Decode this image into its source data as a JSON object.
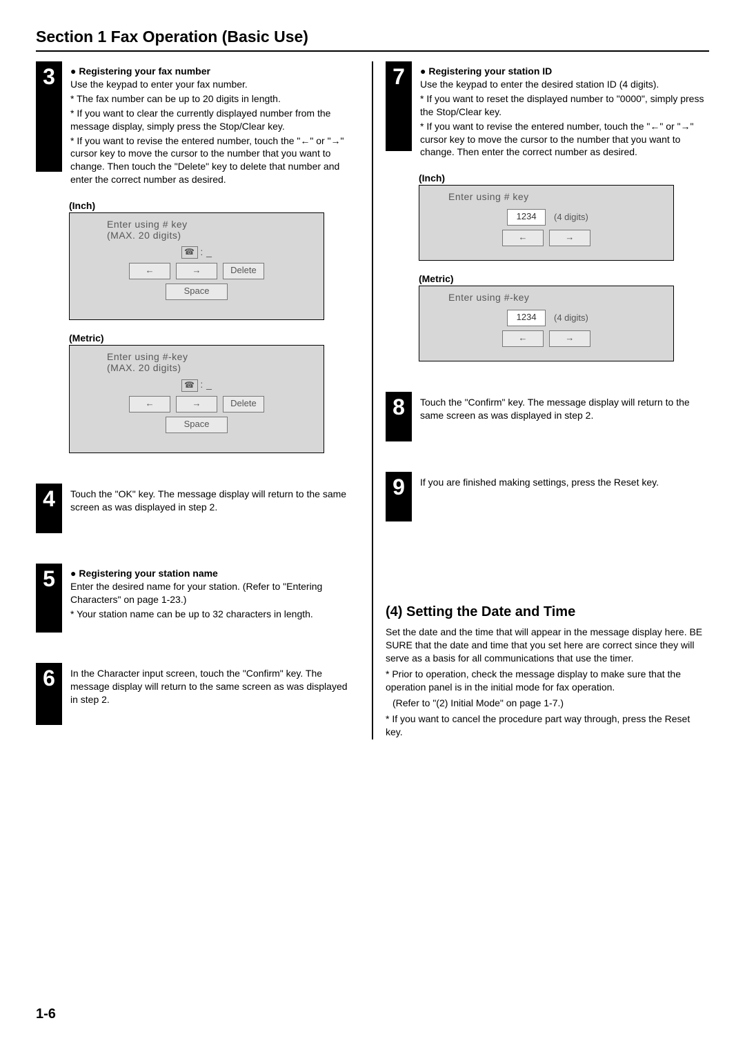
{
  "page": {
    "section_title": "Section 1  Fax Operation (Basic Use)",
    "page_number": "1-6"
  },
  "left": {
    "step3": {
      "num": "3",
      "heading": "Registering your fax number",
      "intro": "Use the keypad to enter your fax number.",
      "note1": "* The fax number can be up to 20 digits in length.",
      "note2": "* If you want to clear the currently displayed number from the message display, simply press the Stop/Clear key.",
      "note3": "* If you want to revise the entered number, touch the \"←\" or \"→\" cursor key to move the cursor to the number that you want to change. Then touch the \"Delete\" key to delete that number and enter the correct number as desired.",
      "inch_label": "(Inch)",
      "metric_label": "(Metric)",
      "screenshot_inch": {
        "line1": "Enter using # key",
        "line2": "(MAX. 20 digits)",
        "input_colon": ": _",
        "btn_left": "←",
        "btn_right": "→",
        "btn_delete": "Delete",
        "btn_space": "Space"
      },
      "screenshot_metric": {
        "line1": "Enter using #-key",
        "line2": "(MAX. 20 digits)",
        "input_colon": ": _",
        "btn_left": "←",
        "btn_right": "→",
        "btn_delete": "Delete",
        "btn_space": "Space"
      }
    },
    "step4": {
      "num": "4",
      "body": "Touch the \"OK\" key. The message display will return to the same screen as was displayed in step 2."
    },
    "step5": {
      "num": "5",
      "heading": "Registering your station name",
      "body": "Enter the desired name for your station. (Refer to \"Entering Characters\" on page 1-23.)",
      "note1": "* Your station name can be up to 32 characters in length."
    },
    "step6": {
      "num": "6",
      "body": "In the Character input screen, touch the \"Confirm\" key. The message display will return to the same screen as was displayed in step 2."
    }
  },
  "right": {
    "step7": {
      "num": "7",
      "heading": "Registering your station ID",
      "intro": "Use the keypad to enter the desired station ID (4 digits).",
      "note1": "* If you want to reset the displayed number to \"0000\", simply press the Stop/Clear key.",
      "note2": "* If you want to revise the entered number, touch the \"←\" or \"→\" cursor key to move the cursor to the number that you want to change. Then enter the correct number as desired.",
      "inch_label": "(Inch)",
      "metric_label": "(Metric)",
      "screenshot_inch": {
        "line1": "Enter using # key",
        "display": "1234",
        "digits_label": "(4 digits)",
        "btn_left": "←",
        "btn_right": "→"
      },
      "screenshot_metric": {
        "line1": "Enter using #-key",
        "display": "1234",
        "digits_label": "(4 digits)",
        "btn_left": "←",
        "btn_right": "→"
      }
    },
    "step8": {
      "num": "8",
      "body": "Touch the \"Confirm\" key. The message display will return to the same screen as was displayed in step 2."
    },
    "step9": {
      "num": "9",
      "body": "If you are finished making settings, press the Reset key."
    },
    "setting_heading": "(4) Setting the Date and Time",
    "setting_body": "Set the date and the time that will appear in the message display here. BE SURE that the date and time that you set here are correct since they will serve as a basis for all communications that use the timer.",
    "setting_note1": "* Prior to operation, check the message display to make sure that the operation panel is in the initial mode for fax operation.",
    "setting_note1b": "(Refer to \"(2) Initial Mode\" on page 1-7.)",
    "setting_note2": "* If you want to cancel the procedure part way through, press the Reset key."
  }
}
